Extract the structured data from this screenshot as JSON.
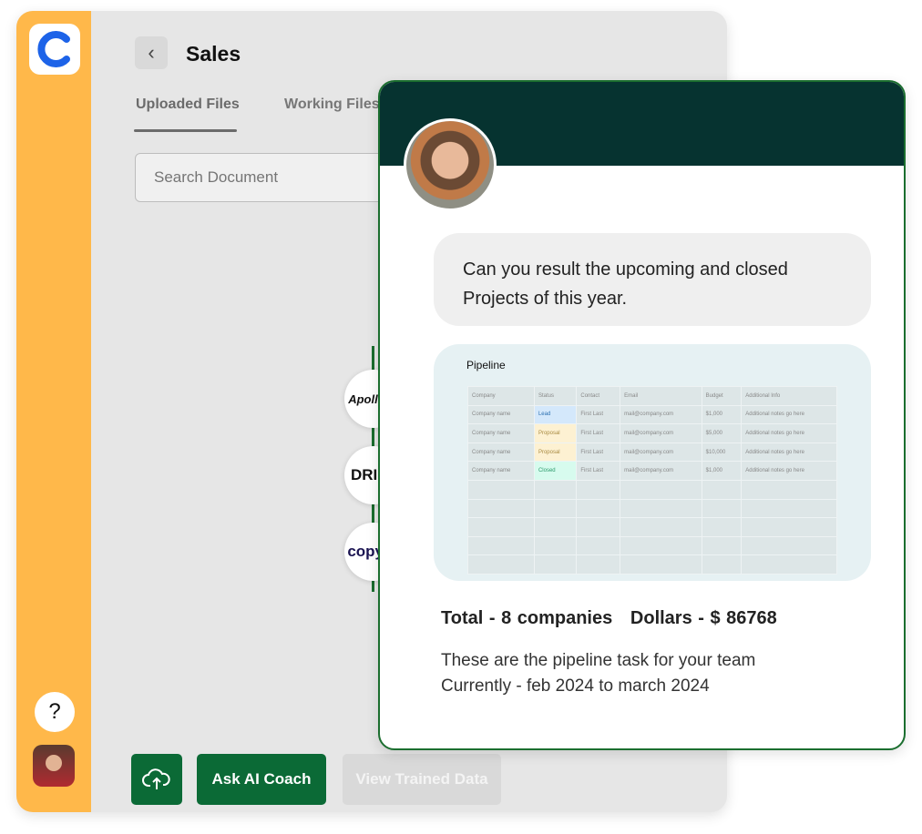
{
  "sidebar": {
    "logo": "C",
    "help": "?"
  },
  "header": {
    "title": "Sales",
    "back_icon": "chevron-left-icon"
  },
  "tabs": [
    {
      "label": "Uploaded Files",
      "active": true
    },
    {
      "label": "Working Files",
      "active": false
    }
  ],
  "search": {
    "placeholder": "Search Document"
  },
  "buttons": {
    "upload": "upload-cloud-icon",
    "ask": "Ask AI Coach",
    "view": "View Trained Data"
  },
  "chat": {
    "question": "Can you result the upcoming and closed Projects of this year.",
    "pipeline": {
      "title": "Pipeline",
      "headers": [
        "Company",
        "Status",
        "Contact",
        "Email",
        "Budget",
        "Additional Info"
      ],
      "rows": [
        [
          "Company name",
          "Lead",
          "First Last",
          "mail@company.com",
          "$1,000",
          "Additional notes go here"
        ],
        [
          "Company name",
          "Proposal",
          "First Last",
          "mail@company.com",
          "$5,000",
          "Additional notes go here"
        ],
        [
          "Company name",
          "Proposal",
          "First Last",
          "mail@company.com",
          "$10,000",
          "Additional notes go here"
        ],
        [
          "Company name",
          "Closed",
          "First Last",
          "mail@company.com",
          "$1,000",
          "Additional notes go here"
        ]
      ]
    },
    "total": "Total - 8 companies",
    "dollars": "Dollars - $ 86768",
    "desc1": "These are the pipeline task for your team",
    "desc2": "Currently - feb 2024 to march 2024"
  },
  "integrations": [
    "Apollo.io",
    "DRIFT",
    "copy.ai"
  ],
  "colors": {
    "sidebar": "#ffb84a",
    "primary": "#0b6a36",
    "header": "#063330",
    "lead": "#d4e8fb",
    "proposal": "#fdf1d2",
    "closed": "#d7fbee"
  }
}
